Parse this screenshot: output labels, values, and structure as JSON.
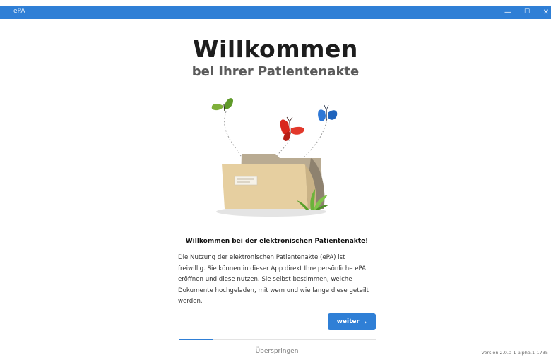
{
  "window": {
    "title": "ePA",
    "controls": {
      "minimize": "—",
      "maximize": "☐",
      "close": "✕"
    }
  },
  "header": {
    "title": "Willkommen",
    "subtitle": "bei Ihrer Patientenakte"
  },
  "illustration": {
    "icons": [
      "butterfly-green-icon",
      "butterfly-red-icon",
      "butterfly-blue-icon",
      "folder-icon",
      "plant-icon"
    ],
    "colors": {
      "folder": "#e6cfa0",
      "folder_back": "#b9ab92",
      "green": "#7fb03a",
      "red": "#d9261c",
      "blue": "#2e78d6"
    }
  },
  "intro": {
    "title": "Willkommen bei der elektronischen Patientenakte!",
    "lines": [
      "Die Nutzung der elektronischen Patientenakte (ePA) ist",
      "freiwillig. Sie können in dieser App direkt Ihre persönliche ePA",
      "eröffnen und diese nutzen. Sie selbst bestimmen, welche",
      "Dokumente hochgeladen, mit wem und wie lange diese geteilt",
      "werden."
    ]
  },
  "actions": {
    "next_label": "weiter",
    "next_icon": "chevron-right-icon",
    "skip_label": "Überspringen"
  },
  "progress": {
    "value": 0.17,
    "accent": "#2f7fd6"
  },
  "footer": {
    "version": "Version 2.0.0-1-alpha.1-1735"
  }
}
